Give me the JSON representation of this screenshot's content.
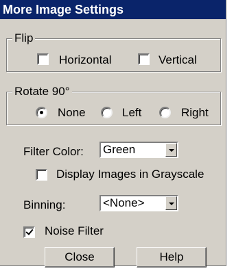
{
  "window": {
    "title": "More Image Settings"
  },
  "flip": {
    "label": "Flip",
    "horizontal": {
      "label": "Horizontal",
      "checked": false
    },
    "vertical": {
      "label": "Vertical",
      "checked": false
    }
  },
  "rotate": {
    "label": "Rotate 90°",
    "options": [
      "None",
      "Left",
      "Right"
    ],
    "selected": "None"
  },
  "filter_color": {
    "label": "Filter Color:",
    "value": "Green"
  },
  "grayscale": {
    "label": "Display Images in Grayscale",
    "checked": false
  },
  "binning": {
    "label": "Binning:",
    "value": "<None>"
  },
  "noise_filter": {
    "label": "Noise Filter",
    "checked": true
  },
  "buttons": {
    "close": "Close",
    "help": "Help"
  }
}
